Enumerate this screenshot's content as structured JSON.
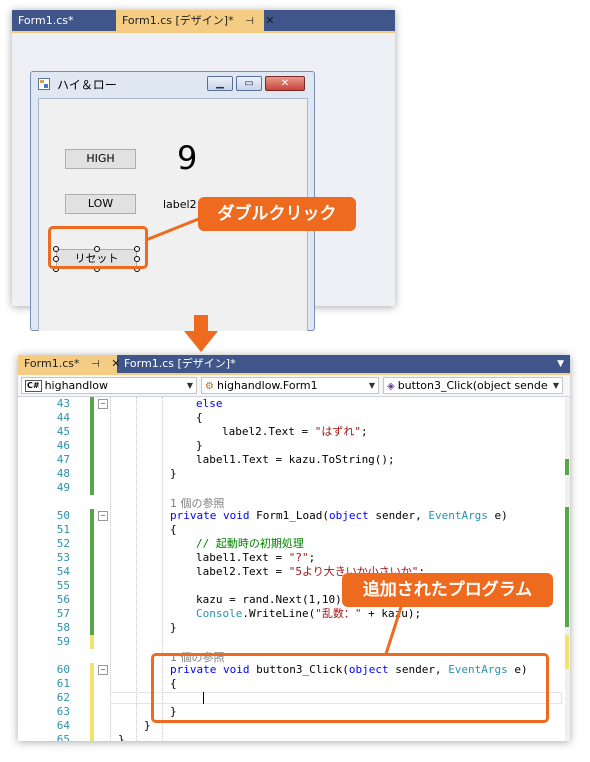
{
  "designer": {
    "tabs": [
      {
        "label": "Form1.cs*",
        "active": false
      },
      {
        "label": "Form1.cs [デザイン]*",
        "active": true,
        "pin_icon": "pin-icon",
        "close_icon": "close-icon"
      }
    ],
    "form": {
      "title": "ハイ＆ロー",
      "buttons": {
        "high": "HIGH",
        "low": "LOW",
        "reset": "リセット"
      },
      "label1_value": "9",
      "label2_value": "label2"
    },
    "callout": "ダブルクリック"
  },
  "editor": {
    "tabs": [
      {
        "label": "Form1.cs*",
        "active": true,
        "pin_icon": "pin-icon",
        "close_icon": "close-icon"
      },
      {
        "label": "Form1.cs [デザイン]*",
        "active": false
      }
    ],
    "nav": {
      "project": "highandlow",
      "class": "highandlow.Form1",
      "member": "button3_Click(object sende"
    },
    "callout": "追加されたプログラム",
    "lines": [
      {
        "n": "43",
        "indent": 3,
        "text": "else"
      },
      {
        "n": "44",
        "indent": 3,
        "text": "{"
      },
      {
        "n": "45",
        "indent": 4,
        "text": "label2.Text = \"はずれ\";"
      },
      {
        "n": "46",
        "indent": 3,
        "text": "}"
      },
      {
        "n": "47",
        "indent": 3,
        "text": "label1.Text = kazu.ToString();"
      },
      {
        "n": "48",
        "indent": 2,
        "text": "}"
      },
      {
        "n": "49",
        "indent": 0,
        "text": ""
      },
      {
        "n": "50",
        "indent": 2,
        "text": "private void Form1_Load(object sender, EventArgs e)",
        "lens": "1 個の参照"
      },
      {
        "n": "51",
        "indent": 2,
        "text": "{"
      },
      {
        "n": "52",
        "indent": 3,
        "text": "// 起動時の初期処理"
      },
      {
        "n": "53",
        "indent": 3,
        "text": "label1.Text = \"?\";"
      },
      {
        "n": "54",
        "indent": 3,
        "text": "label2.Text = \"5より大きいか小さいか\";"
      },
      {
        "n": "55",
        "indent": 0,
        "text": ""
      },
      {
        "n": "56",
        "indent": 3,
        "text": "kazu = rand.Next(1,10);"
      },
      {
        "n": "57",
        "indent": 3,
        "text": "Console.WriteLine(\"乱数：\" + kazu);"
      },
      {
        "n": "58",
        "indent": 2,
        "text": "}"
      },
      {
        "n": "59",
        "indent": 0,
        "text": ""
      },
      {
        "n": "60",
        "indent": 2,
        "text": "private void button3_Click(object sender, EventArgs e)",
        "lens": "1 個の参照"
      },
      {
        "n": "61",
        "indent": 2,
        "text": "{"
      },
      {
        "n": "62",
        "indent": 0,
        "text": ""
      },
      {
        "n": "63",
        "indent": 2,
        "text": "}"
      },
      {
        "n": "64",
        "indent": 1,
        "text": "}"
      },
      {
        "n": "65",
        "indent": 0,
        "text": "}"
      }
    ]
  },
  "colors": {
    "tabbar": "#40568a",
    "active_tab": "#f5cc84",
    "callout": "#ee6a1f",
    "keyword": "#0000ff",
    "type": "#2b91af",
    "comment": "#008000",
    "string": "#a31515",
    "change_saved": "#57a64a",
    "change_unsaved": "#f1e36b"
  }
}
